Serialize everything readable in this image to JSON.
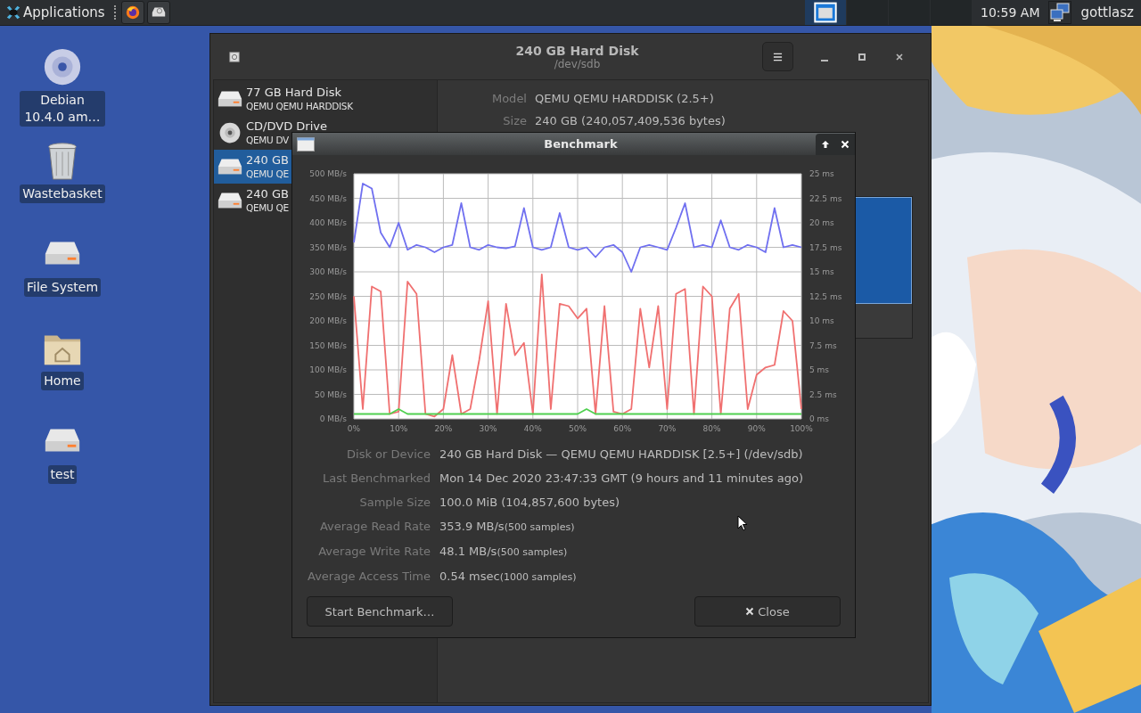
{
  "panel": {
    "apps_label": "Applications",
    "launchers": [
      {
        "kind": "browser"
      },
      {
        "kind": "disks"
      }
    ],
    "workspaces": [
      {
        "selected": true
      },
      {
        "selected": false
      },
      {
        "selected": false
      },
      {
        "selected": false
      }
    ],
    "clock": "10:59 AM",
    "user": "gottlasz"
  },
  "desktop_icons": [
    {
      "kind": "disc",
      "label": "Debian 10.4.0 am…"
    },
    {
      "kind": "trash",
      "label": "Wastebasket"
    },
    {
      "kind": "drive",
      "label": "File System"
    },
    {
      "kind": "home",
      "label": "Home"
    },
    {
      "kind": "drive",
      "label": "test"
    }
  ],
  "window": {
    "title": "240 GB Hard Disk",
    "subtitle": "/dev/sdb"
  },
  "devices": [
    {
      "kind": "disk",
      "name": "77 GB Hard Disk",
      "model": "QEMU QEMU HARDDISK",
      "selected": false
    },
    {
      "kind": "optical",
      "name": "CD/DVD Drive",
      "model": "QEMU DV",
      "selected": false
    },
    {
      "kind": "disk",
      "name": "240 GB",
      "model": "QEMU QE",
      "selected": true
    },
    {
      "kind": "disk",
      "name": "240 GB",
      "model": "QEMU QE",
      "selected": false
    }
  ],
  "details": [
    {
      "label": "Model",
      "value": "QEMU QEMU HARDDISK (2.5+)"
    },
    {
      "label": "Size",
      "value": "240 GB (240,057,409,536 bytes)"
    }
  ],
  "benchmark": {
    "title": "Benchmark",
    "chart_data": {
      "type": "line",
      "grid": true,
      "xlim": [
        0,
        100
      ],
      "ylim": [
        0,
        500
      ],
      "y2lim": [
        0,
        25
      ],
      "x": [
        0,
        2,
        4,
        6,
        8,
        10,
        12,
        14,
        16,
        18,
        20,
        22,
        24,
        26,
        28,
        30,
        32,
        34,
        36,
        38,
        40,
        42,
        44,
        46,
        48,
        50,
        52,
        54,
        56,
        58,
        60,
        62,
        64,
        66,
        68,
        70,
        72,
        74,
        76,
        78,
        80,
        82,
        84,
        86,
        88,
        90,
        92,
        94,
        96,
        98,
        100
      ],
      "xticks": [
        {
          "value": 0,
          "label": "0%"
        },
        {
          "value": 10,
          "label": "10%"
        },
        {
          "value": 20,
          "label": "20%"
        },
        {
          "value": 30,
          "label": "30%"
        },
        {
          "value": 40,
          "label": "40%"
        },
        {
          "value": 50,
          "label": "50%"
        },
        {
          "value": 60,
          "label": "60%"
        },
        {
          "value": 70,
          "label": "70%"
        },
        {
          "value": 80,
          "label": "80%"
        },
        {
          "value": 90,
          "label": "90%"
        },
        {
          "value": 100,
          "label": "100%"
        }
      ],
      "yticks": [
        {
          "value": 0,
          "label": "0 MB/s"
        },
        {
          "value": 50,
          "label": "50 MB/s"
        },
        {
          "value": 100,
          "label": "100 MB/s"
        },
        {
          "value": 150,
          "label": "150 MB/s"
        },
        {
          "value": 200,
          "label": "200 MB/s"
        },
        {
          "value": 250,
          "label": "250 MB/s"
        },
        {
          "value": 300,
          "label": "300 MB/s"
        },
        {
          "value": 350,
          "label": "350 MB/s"
        },
        {
          "value": 400,
          "label": "400 MB/s"
        },
        {
          "value": 450,
          "label": "450 MB/s"
        },
        {
          "value": 500,
          "label": "500 MB/s"
        }
      ],
      "y2ticks": [
        {
          "value": 0,
          "label": "0 ms"
        },
        {
          "value": 2.5,
          "label": "2.5 ms"
        },
        {
          "value": 5,
          "label": "5 ms"
        },
        {
          "value": 7.5,
          "label": "7.5 ms"
        },
        {
          "value": 10,
          "label": "10 ms"
        },
        {
          "value": 12.5,
          "label": "12.5 ms"
        },
        {
          "value": 15,
          "label": "15 ms"
        },
        {
          "value": 17.5,
          "label": "17.5 ms"
        },
        {
          "value": 20,
          "label": "20 ms"
        },
        {
          "value": 22.5,
          "label": "22.5 ms"
        },
        {
          "value": 25,
          "label": "25 ms"
        }
      ],
      "series": [
        {
          "color": "#7070f0",
          "values": [
            360,
            480,
            470,
            380,
            350,
            400,
            345,
            355,
            350,
            340,
            350,
            355,
            440,
            350,
            345,
            355,
            350,
            348,
            352,
            430,
            350,
            345,
            350,
            420,
            350,
            345,
            350,
            330,
            350,
            355,
            340,
            300,
            350,
            355,
            350,
            345,
            390,
            440,
            350,
            355,
            350,
            405,
            350,
            345,
            355,
            350,
            340,
            430,
            350,
            355,
            350
          ]
        },
        {
          "color": "#f07070",
          "values": [
            250,
            20,
            270,
            260,
            10,
            15,
            280,
            255,
            10,
            5,
            20,
            130,
            10,
            20,
            120,
            240,
            10,
            235,
            130,
            155,
            10,
            295,
            20,
            235,
            230,
            205,
            225,
            10,
            230,
            15,
            10,
            20,
            225,
            105,
            230,
            20,
            255,
            265,
            10,
            270,
            250,
            10,
            225,
            255,
            20,
            90,
            105,
            110,
            220,
            200,
            20
          ]
        },
        {
          "color": "#50d050",
          "axis": "y2",
          "values": [
            0.5,
            0.5,
            0.5,
            0.5,
            0.5,
            1,
            0.5,
            0.5,
            0.5,
            0.5,
            0.5,
            0.5,
            0.5,
            0.5,
            0.5,
            0.5,
            0.5,
            0.5,
            0.5,
            0.5,
            0.5,
            0.5,
            0.5,
            0.5,
            0.5,
            0.5,
            1,
            0.5,
            0.5,
            0.5,
            0.5,
            0.5,
            0.5,
            0.5,
            0.5,
            0.5,
            0.5,
            0.5,
            0.5,
            0.5,
            0.5,
            0.5,
            0.5,
            0.5,
            0.5,
            0.5,
            0.5,
            0.5,
            0.5,
            0.5,
            0.5
          ]
        }
      ]
    },
    "info": [
      {
        "label": "Disk or Device",
        "value": "240 GB Hard Disk — QEMU QEMU HARDDISK [2.5+] (/dev/sdb)"
      },
      {
        "label": "Last Benchmarked",
        "value": "Mon 14 Dec 2020 23:47:33 GMT (9 hours and 11 minutes ago)"
      },
      {
        "label": "Sample Size",
        "value": "100.0 MiB (104,857,600 bytes)"
      },
      {
        "label": "Average Read Rate",
        "value": "353.9 MB/s",
        "note": "(500 samples)"
      },
      {
        "label": "Average Write Rate",
        "value": "48.1 MB/s",
        "note": "(500 samples)"
      },
      {
        "label": "Average Access Time",
        "value": "0.54 msec",
        "note": "(1000 samples)"
      }
    ],
    "start_button": "Start Benchmark…",
    "close_button": "Close"
  }
}
